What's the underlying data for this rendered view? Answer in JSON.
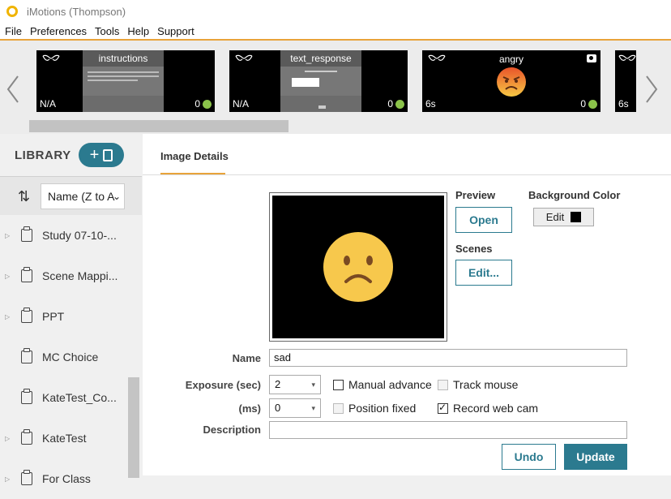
{
  "window": {
    "title": "iMotions (Thompson)"
  },
  "menu": [
    "File",
    "Preferences",
    "Tools",
    "Help",
    "Support"
  ],
  "timeline": {
    "items": [
      {
        "title": "instructions",
        "left_label": "N/A",
        "count": "0"
      },
      {
        "title": "text_response",
        "left_label": "N/A",
        "count": "0"
      },
      {
        "title": "angry",
        "left_label": "6s",
        "count": "0"
      },
      {
        "title": "",
        "left_label": "6s",
        "count": ""
      }
    ]
  },
  "library": {
    "title": "LIBRARY",
    "add_symbol": "+",
    "sort_label": "Name (Z to A",
    "items": [
      {
        "name": "Study 07-10-..."
      },
      {
        "name": "Scene Mappi..."
      },
      {
        "name": "PPT"
      },
      {
        "name": "MC Choice"
      },
      {
        "name": "KateTest_Co..."
      },
      {
        "name": "KateTest"
      },
      {
        "name": "For Class"
      }
    ]
  },
  "details": {
    "tab": "Image Details",
    "preview_label": "Preview",
    "open_label": "Open",
    "scenes_label": "Scenes",
    "edit_scenes_label": "Edit...",
    "bg_color_label": "Background Color",
    "bg_edit_label": "Edit",
    "bg_color": "#000000",
    "name_label": "Name",
    "name_value": "sad",
    "exposure_label": "Exposure (sec)",
    "exposure_value": "2",
    "ms_label": "(ms)",
    "ms_value": "0",
    "manual_advance": "Manual advance",
    "track_mouse": "Track mouse",
    "position_fixed": "Position fixed",
    "record_web_cam": "Record web cam",
    "description_label": "Description",
    "description_value": "",
    "undo_label": "Undo",
    "update_label": "Update"
  },
  "colors": {
    "accent": "#2b7a8f",
    "highlight": "#e8a33a",
    "status_green": "#8bc34a"
  }
}
